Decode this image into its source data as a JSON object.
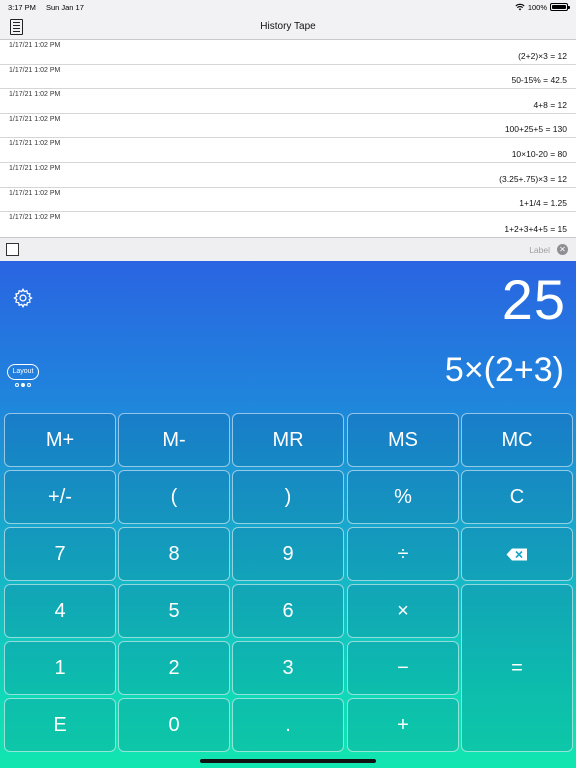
{
  "status": {
    "time": "3:17 PM",
    "date": "Sun Jan 17",
    "battery": "100%"
  },
  "nav": {
    "title": "History Tape"
  },
  "history": [
    {
      "time": "1/17/21 1:02 PM",
      "expr": "(2+2)×3 = 12"
    },
    {
      "time": "1/17/21 1:02 PM",
      "expr": "50-15% = 42.5"
    },
    {
      "time": "1/17/21 1:02 PM",
      "expr": "4+8 = 12"
    },
    {
      "time": "1/17/21 1:02 PM",
      "expr": "100+25+5 = 130"
    },
    {
      "time": "1/17/21 1:02 PM",
      "expr": "10×10-20 = 80"
    },
    {
      "time": "1/17/21 1:02 PM",
      "expr": "(3.25+.75)×3 = 12"
    },
    {
      "time": "1/17/21 1:02 PM",
      "expr": "1+1/4 = 1.25"
    },
    {
      "time": "1/17/21 1:02 PM",
      "expr": "1+2+3+4+5 = 15"
    }
  ],
  "label_bar": {
    "placeholder": "Label"
  },
  "calc": {
    "display": "25",
    "expression": "5×(2+3)",
    "layout_label": "Layout",
    "keys": {
      "m_plus": "M+",
      "m_minus": "M-",
      "mr": "MR",
      "ms": "MS",
      "mc": "MC",
      "plus_minus": "+/-",
      "paren_open": "(",
      "paren_close": ")",
      "percent": "%",
      "clear": "C",
      "seven": "7",
      "eight": "8",
      "nine": "9",
      "divide": "÷",
      "four": "4",
      "five": "5",
      "six": "6",
      "multiply": "×",
      "one": "1",
      "two": "2",
      "three": "3",
      "minus": "−",
      "equals": "=",
      "e": "E",
      "zero": "0",
      "decimal": ".",
      "plus": "+"
    }
  },
  "colors": {
    "gradient_top": "#2a64e2",
    "gradient_bottom": "#12e6b0"
  }
}
